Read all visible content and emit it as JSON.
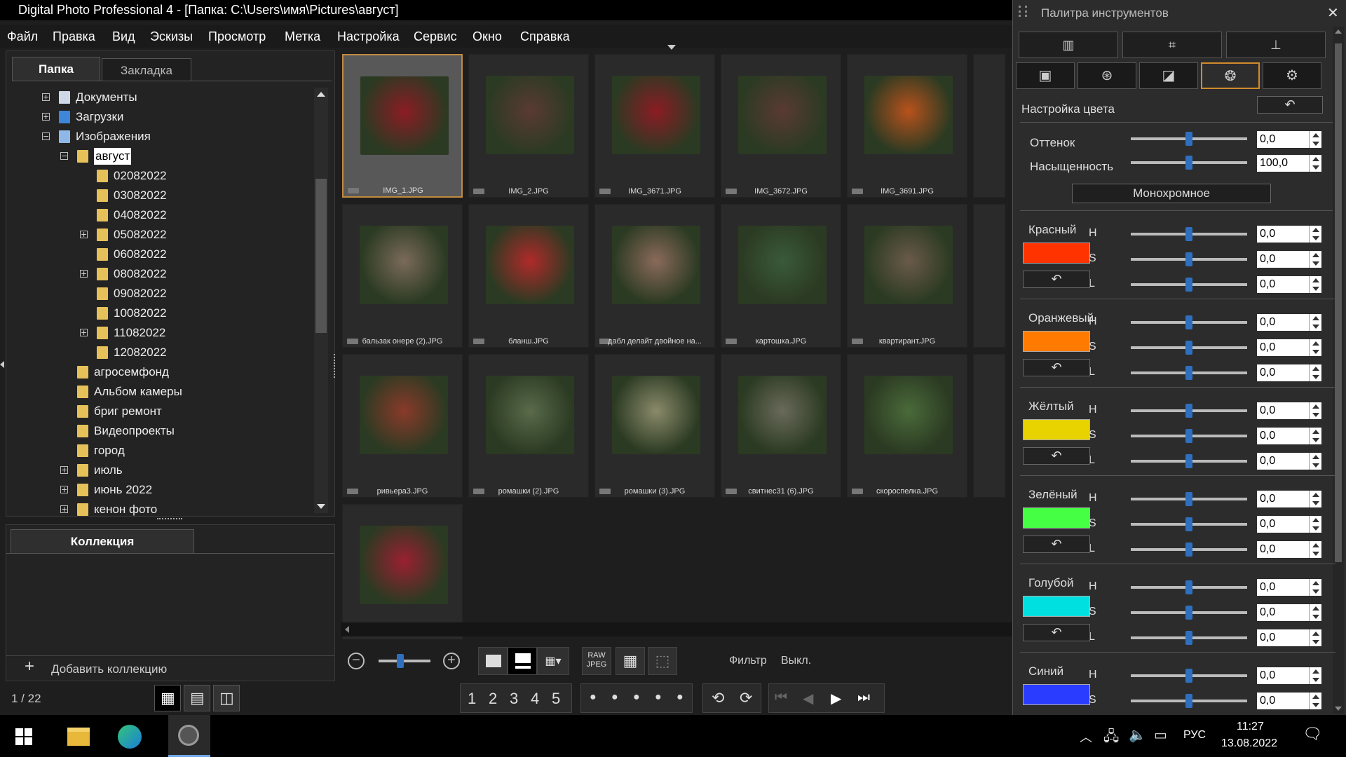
{
  "window": {
    "title": "Digital Photo Professional 4 - [Папка: C:\\Users\\имя\\Pictures\\август]"
  },
  "menu": [
    "Файл",
    "Правка",
    "Вид",
    "Эскизы",
    "Просмотр",
    "Метка",
    "Настройка",
    "Сервис",
    "Окно",
    "Справка"
  ],
  "left_tabs": {
    "folder": "Папка",
    "bookmark": "Закладка"
  },
  "tree": [
    {
      "label": "Документы",
      "level": 1,
      "expander": "+",
      "icon": "documents-icon"
    },
    {
      "label": "Загрузки",
      "level": 1,
      "expander": "+",
      "icon": "downloads-icon"
    },
    {
      "label": "Изображения",
      "level": 1,
      "expander": "-",
      "icon": "pictures-icon"
    },
    {
      "label": "август",
      "level": 2,
      "expander": "-",
      "selected": true
    },
    {
      "label": "02082022",
      "level": 3
    },
    {
      "label": "03082022",
      "level": 3
    },
    {
      "label": "04082022",
      "level": 3
    },
    {
      "label": "05082022",
      "level": 3,
      "expander": "+"
    },
    {
      "label": "06082022",
      "level": 3
    },
    {
      "label": "08082022",
      "level": 3,
      "expander": "+"
    },
    {
      "label": "09082022",
      "level": 3
    },
    {
      "label": "10082022",
      "level": 3
    },
    {
      "label": "11082022",
      "level": 3,
      "expander": "+"
    },
    {
      "label": "12082022",
      "level": 3
    },
    {
      "label": "агросемфонд",
      "level": 2
    },
    {
      "label": "Альбом камеры",
      "level": 2
    },
    {
      "label": "бриг ремонт",
      "level": 2
    },
    {
      "label": "Видеопроекты",
      "level": 2
    },
    {
      "label": "город",
      "level": 2
    },
    {
      "label": "июль",
      "level": 2,
      "expander": "+"
    },
    {
      "label": "июнь 2022",
      "level": 2,
      "expander": "+"
    },
    {
      "label": "кенон фото",
      "level": 2,
      "expander": "+"
    }
  ],
  "collection": {
    "title": "Коллекция",
    "add": "Добавить коллекцию"
  },
  "thumbs": [
    {
      "name": "IMG_1.JPG",
      "color": "#8b1c24",
      "selected": true
    },
    {
      "name": "IMG_2.JPG",
      "color": "#5a3a34"
    },
    {
      "name": "IMG_3671.JPG",
      "color": "#8b1c24"
    },
    {
      "name": "IMG_3672.JPG",
      "color": "#5a3a34"
    },
    {
      "name": "IMG_3691.JPG",
      "color": "#b8521c"
    },
    {
      "name": "бальзак онере (2).JPG",
      "color": "#7a6a5a"
    },
    {
      "name": "бланш.JPG",
      "color": "#b02a2a"
    },
    {
      "name": "дабл делайт двойное на...",
      "color": "#8a6a5a"
    },
    {
      "name": "картошка.JPG",
      "color": "#3a5a3a"
    },
    {
      "name": "квартирант.JPG",
      "color": "#6a5a4a"
    },
    {
      "name": "ривьера3.JPG",
      "color": "#8a3a2a"
    },
    {
      "name": "ромашки (2).JPG",
      "color": "#5a6a4a"
    },
    {
      "name": "ромашки (3).JPG",
      "color": "#8a8a6a"
    },
    {
      "name": "свитнес31 (6).JPG",
      "color": "#6a6a5a"
    },
    {
      "name": "скороспелка.JPG",
      "color": "#4a6a3a"
    },
    {
      "name": "",
      "color": "#9a2030"
    }
  ],
  "toolbar": {
    "raw_label": "RAW",
    "jpeg_label": "JPEG",
    "filter_label": "Фильтр",
    "filter_value": "Выкл."
  },
  "status": {
    "count": "1 / 22"
  },
  "rating_buttons": [
    "1",
    "2",
    "3",
    "4",
    "5"
  ],
  "palette": {
    "title": "Палитра инструментов",
    "section_title": "Настройка цвета",
    "hue_label": "Оттенок",
    "hue_value": "0,0",
    "sat_label": "Насыщенность",
    "sat_value": "100,0",
    "mono_label": "Монохромное",
    "colors": [
      {
        "name": "Красный",
        "swatch": "#ff3300",
        "h": "0,0",
        "s": "0,0",
        "l": "0,0"
      },
      {
        "name": "Оранжевый",
        "swatch": "#ff7a00",
        "h": "0,0",
        "s": "0,0",
        "l": "0,0"
      },
      {
        "name": "Жёлтый",
        "swatch": "#e8d200",
        "h": "0,0",
        "s": "0,0",
        "l": "0,0"
      },
      {
        "name": "Зелёный",
        "swatch": "#44ff44",
        "h": "0,0",
        "s": "0,0",
        "l": "0,0"
      },
      {
        "name": "Голубой",
        "swatch": "#00e0e0",
        "h": "0,0",
        "s": "0,0",
        "l": "0,0"
      },
      {
        "name": "Синий",
        "swatch": "#2a3cff",
        "h": "0,0",
        "s": "0,0"
      }
    ],
    "letters": {
      "h": "H",
      "s": "S",
      "l": "L"
    }
  },
  "taskbar": {
    "lang": "РУС",
    "time": "11:27",
    "date": "13.08.2022"
  }
}
